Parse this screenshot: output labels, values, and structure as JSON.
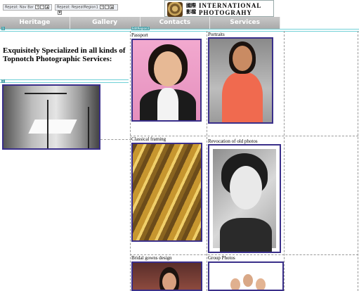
{
  "editor": {
    "repeat1_label": "Repeat: Nav Bar",
    "repeat2_label": "Repeat: RepeatRegion1",
    "region_tag_1": "1",
    "region_tag_2": "EditRegion3",
    "region_tag_3": "3"
  },
  "brand": {
    "name_cn": "國際\n影檔",
    "name_en": "INTERNATIONAL\nPHOTOGRAHY"
  },
  "nav": {
    "items": [
      "Heritage",
      "Gallery",
      "Contacts",
      "Services"
    ]
  },
  "left": {
    "heading": "Exquisitely Specialized in all kinds of Topnotch Photographic Services:"
  },
  "gallery": {
    "items": [
      {
        "caption": "Passport"
      },
      {
        "caption": "Portraits"
      },
      {
        "caption": "Classical framing"
      },
      {
        "caption": "Revocation of old photos"
      },
      {
        "caption": "Bridal gowns design"
      },
      {
        "caption": "Group Photos"
      }
    ]
  },
  "colors": {
    "accent_border": "#3a2f8a",
    "nav_bg": "#b8b8b8",
    "guide_line": "#6fd0d6"
  }
}
